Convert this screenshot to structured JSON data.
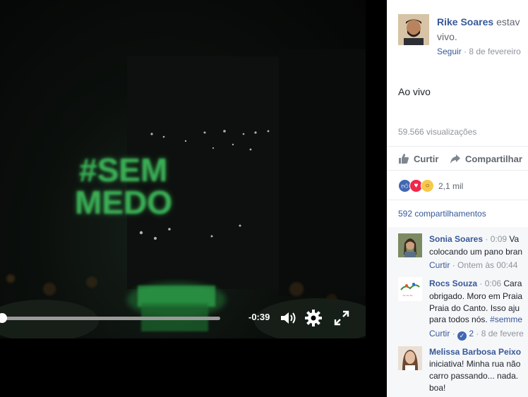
{
  "video": {
    "projection_lines": [
      "#SEM",
      "MEDO"
    ],
    "time_remaining": "-0:39",
    "progress_fraction": 0.0,
    "colors": {
      "projection": "#3db85a",
      "glow": "#4be06a"
    }
  },
  "post": {
    "author": "Rike Soares",
    "author_suffix": "estav",
    "author_line2": "vivo.",
    "follow_label": "Seguir",
    "date": "· 8 de fevereiro",
    "caption": "Ao vivo",
    "views": "59.566 visualizações",
    "like_label": "Curtir",
    "share_label": "Compartilhar",
    "reaction_count": "2,1 mil",
    "shares": "592 compartilhamentos"
  },
  "comments": [
    {
      "name": "Sonia Soares",
      "time": "· 0:09",
      "lines": [
        "Va",
        "colocando um pano bran"
      ],
      "like_label": "Curtir",
      "meta": "· Ontem às 00:44"
    },
    {
      "name": "Rocs Souza",
      "time": "· 0:06",
      "lines": [
        "Cara",
        "obrigado. Moro em Praia",
        "Praia do Canto. Isso aju",
        "para todos nós."
      ],
      "hashtag": "#semme",
      "like_label": "Curtir",
      "likes": "2",
      "meta": "· 8 de fevere"
    },
    {
      "name": "Melissa Barbosa Peixo",
      "lines": [
        "iniciativa! Minha rua não",
        "carro passando... nada.",
        "boa!"
      ]
    }
  ]
}
